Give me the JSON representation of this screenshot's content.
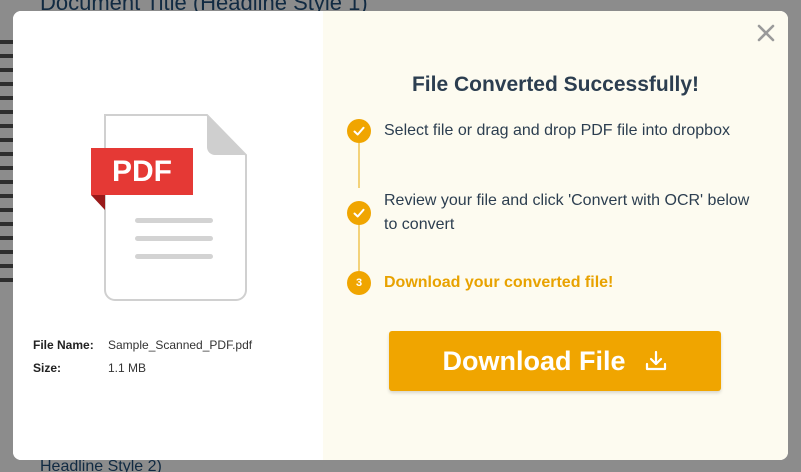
{
  "background": {
    "title": "Document Title (Headline Style 1)",
    "footer": "Headline Style 2)"
  },
  "modal": {
    "heading": "File Converted Successfully!",
    "steps": [
      {
        "label": "Select file or drag and drop PDF file into dropbox",
        "status": "done"
      },
      {
        "label": "Review your file and click 'Convert with OCR' below to convert",
        "status": "done"
      },
      {
        "label": "Download your converted file!",
        "status": "active",
        "number": "3"
      }
    ],
    "file_info": {
      "name_label": "File Name:",
      "name_value": "Sample_Scanned_PDF.pdf",
      "size_label": "Size:",
      "size_value": "1.1 MB"
    },
    "pdf_badge": "PDF",
    "download_button": "Download File",
    "icons": {
      "close": "close-icon",
      "check": "check-icon",
      "download": "download-icon",
      "file": "pdf-file-icon"
    },
    "colors": {
      "accent": "#f0a500",
      "heading": "#2c3e50",
      "pdf_red": "#e53935",
      "right_pane_bg": "#fdfbf0"
    }
  }
}
